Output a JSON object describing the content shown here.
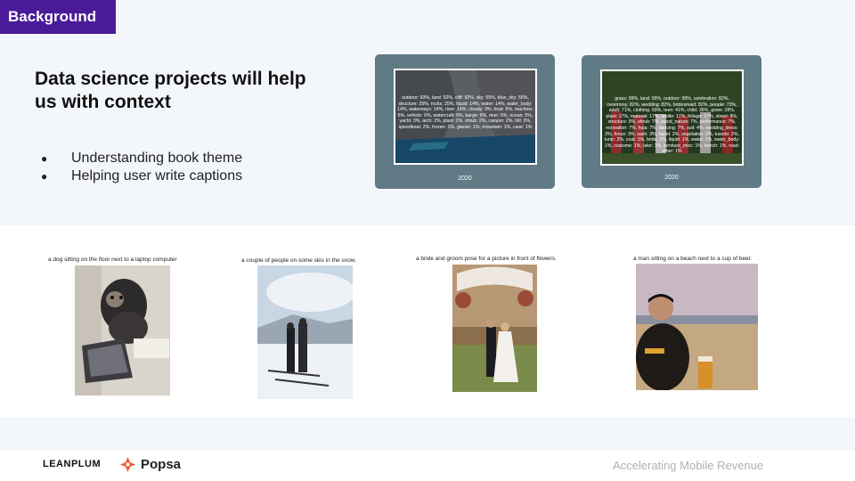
{
  "section_tag": "Background",
  "title": "Data science projects will help us with context",
  "bullets": [
    "Understanding book theme",
    "Helping user write captions"
  ],
  "cards": [
    {
      "tags": "outdoor: 93%, land: 92%, cliff: 92%, sky: 55%, blue_sky: 55%, structure: 25%, rocks: 25%, liquid: 14%, water: 14%, water_body: 14%, waterways: 14%, river: 14%, cloudy: 9%, boat: 6%, machine: 6%, vehicle: 6%, watercraft: 6%, barge: 6%, river: 5%, ocean: 5%, yacht: 3%, arch: 2%, plant: 2%, shrub: 2%, canyon: 2%, hill: 2%, speedboat: 2%, frozen: 1%, glacier: 1%, mountain: 1%, cave: 1%",
      "year": "2020"
    },
    {
      "tags": "grass: 99%, land: 99%, outdoor: 99%, celebration: 82%, ceremony: 82%, wedding: 82%, bridesmaid: 82%, people: 73%, adult: 71%, clothing: 59%, teen: 41%, child: 38%, gown: 28%, plant: 17%, material: 17%, textile: 17%, foliage: 17%, street: 9%, structure: 9%, shrub: 7%, wood_nature: 7%, performance: 7%, recreation: 7%, hula: 7%, dancing: 7%, suit: 4%, wedding_dress: 3%, fence: 3%, sash: 3%, ballet: 2%, vegetation: 2%, tuxedo: 2%, tunic: 2%, coat: 1%, bride: 1%, liquid: 1%, water: 1%, water_body: 1%, costume: 1%, lake: 1%, furniture_misc: 1%, bench: 1%, road: other: 1%",
      "year": "2020"
    }
  ],
  "captions": [
    "a dog sitting on the floor next to a laptop computer",
    "a couple of people on some skis in the snow.",
    "a bride and groom pose for a picture in front of flowers.",
    "a man sitting on a beach next to a cup of beer."
  ],
  "footer": {
    "logo_left": "LEANPLUM",
    "logo_right": "Popsa",
    "tagline": "Accelerating Mobile Revenue"
  },
  "colors": {
    "accent": "#4a1a99",
    "card": "#607a86",
    "popsa": "#f0572a"
  }
}
